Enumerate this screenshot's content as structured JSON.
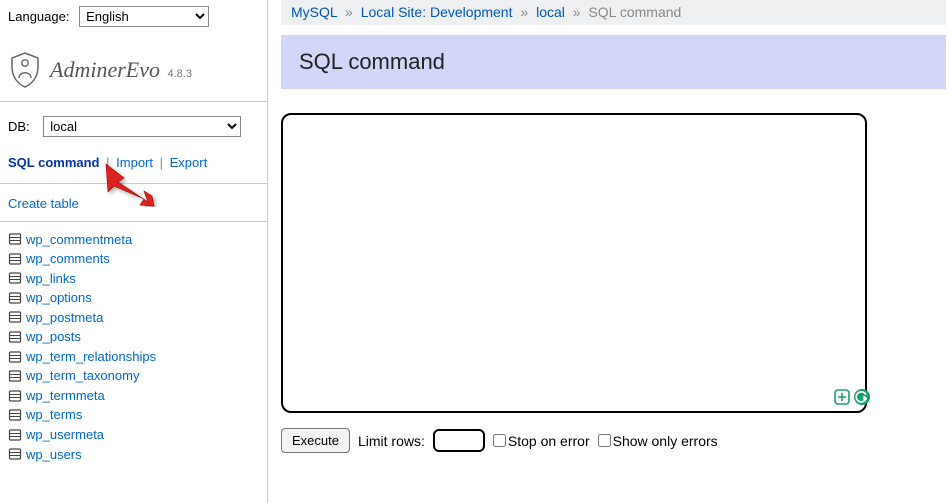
{
  "sidebar": {
    "language_label": "Language:",
    "language_value": "English",
    "app_name": "AdminerEvo",
    "version": "4.8.3",
    "db_label": "DB:",
    "db_value": "local",
    "links": {
      "sql_command": "SQL command",
      "import": "Import",
      "export": "Export"
    },
    "create_table": "Create table",
    "tables": [
      "wp_commentmeta",
      "wp_comments",
      "wp_links",
      "wp_options",
      "wp_postmeta",
      "wp_posts",
      "wp_term_relationships",
      "wp_term_taxonomy",
      "wp_termmeta",
      "wp_terms",
      "wp_usermeta",
      "wp_users"
    ]
  },
  "breadcrumb": {
    "mysql": "MySQL",
    "server": "Local Site: Development",
    "db": "local",
    "current": "SQL command"
  },
  "page": {
    "title": "SQL command",
    "textarea_value": "",
    "execute": "Execute",
    "limit_rows_label": "Limit rows:",
    "limit_rows_value": "",
    "stop_on_error": "Stop on error",
    "show_only_errors": "Show only errors"
  }
}
